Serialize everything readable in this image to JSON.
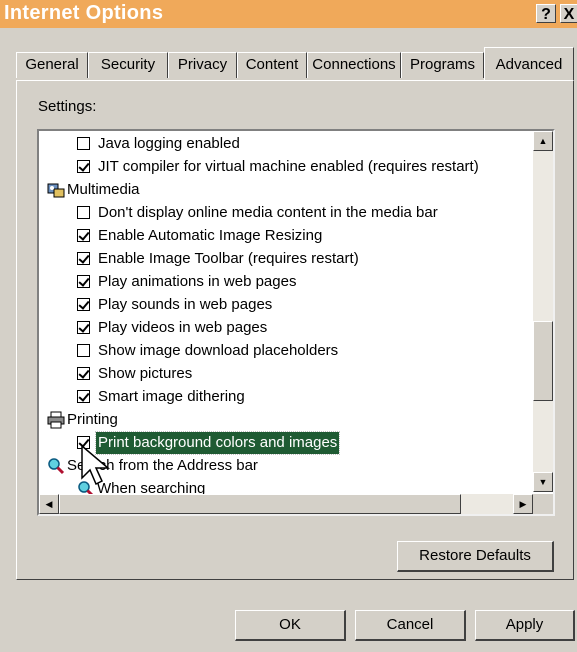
{
  "window": {
    "title": "Internet Options",
    "help_label": "?",
    "close_label": "X"
  },
  "tabs": [
    {
      "label": "General"
    },
    {
      "label": "Security"
    },
    {
      "label": "Privacy"
    },
    {
      "label": "Content"
    },
    {
      "label": "Connections"
    },
    {
      "label": "Programs"
    },
    {
      "label": "Advanced"
    }
  ],
  "settings": {
    "label": "Settings:",
    "items": [
      {
        "type": "option",
        "label": "Java logging enabled",
        "checked": false
      },
      {
        "type": "option",
        "label": "JIT compiler for virtual machine enabled (requires restart)",
        "checked": true
      },
      {
        "type": "category",
        "label": "Multimedia",
        "icon": "multimedia-icon"
      },
      {
        "type": "option",
        "label": "Don't display online media content in the media bar",
        "checked": false
      },
      {
        "type": "option",
        "label": "Enable Automatic Image Resizing",
        "checked": true
      },
      {
        "type": "option",
        "label": "Enable Image Toolbar (requires restart)",
        "checked": true
      },
      {
        "type": "option",
        "label": "Play animations in web pages",
        "checked": true
      },
      {
        "type": "option",
        "label": "Play sounds in web pages",
        "checked": true
      },
      {
        "type": "option",
        "label": "Play videos in web pages",
        "checked": true
      },
      {
        "type": "option",
        "label": "Show image download placeholders",
        "checked": false
      },
      {
        "type": "option",
        "label": "Show pictures",
        "checked": true
      },
      {
        "type": "option",
        "label": "Smart image dithering",
        "checked": true
      },
      {
        "type": "category",
        "label": "Printing",
        "icon": "printer-icon"
      },
      {
        "type": "option",
        "label": "Print background colors and images",
        "checked": true,
        "selected": true
      },
      {
        "type": "category",
        "label": "Search from the Address bar",
        "icon": "search-icon"
      },
      {
        "type": "category",
        "label": "When searching",
        "icon": "search-icon"
      }
    ]
  },
  "buttons": {
    "restore_defaults": "Restore Defaults",
    "ok": "OK",
    "cancel": "Cancel",
    "apply": "Apply"
  },
  "colors": {
    "titlebar": "#f0a95a",
    "selection": "#1f5b33",
    "face": "#d4d0c8"
  }
}
